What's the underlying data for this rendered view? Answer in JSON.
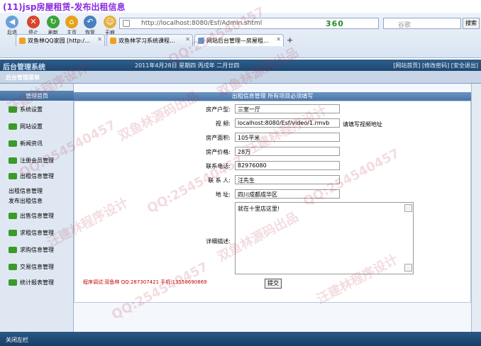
{
  "caption": "(11)jsp房屋租赁-发布出租信息",
  "browser": {
    "nav_buttons": [
      "后退",
      "停止",
      "刷新",
      "主页",
      "恢复",
      "无痕"
    ],
    "address": "http://localhost:8080/Esf/Admin.shtml",
    "brand": "360",
    "search_placeholder": "谷歌",
    "search_button": "搜索",
    "tabs": [
      {
        "label": "双鱼林QQ家园 [http:/..."
      },
      {
        "label": "双鱼林学习系统课程..."
      },
      {
        "label": "网站后台管理—房屋租..."
      }
    ],
    "new_tab": "+"
  },
  "app": {
    "title": "后台管理系统",
    "date_text": "2011年4月28日  星期四  丙戌年  二月廿四",
    "top_links": "[网站首页] [修改密码] [安全退出]",
    "sub_title": "后台管理菜单"
  },
  "sidebar": {
    "head": "管理首页",
    "items": [
      {
        "label": "系统设置"
      },
      {
        "label": "网站设置"
      },
      {
        "label": "新闻资讯"
      },
      {
        "label": "注册会员管理"
      },
      {
        "label": "出租信息管理"
      }
    ],
    "sub_items": [
      "出租信息管理",
      "发布出租信息"
    ],
    "items2": [
      {
        "label": "出售信息管理"
      },
      {
        "label": "求租信息管理"
      },
      {
        "label": "求购信息管理"
      },
      {
        "label": "交易信息管理"
      },
      {
        "label": "统计报表管理"
      }
    ]
  },
  "main": {
    "bar_title": "出租信息管理  所有项目必须填写",
    "fields": {
      "house_type": {
        "label": "房产户型:",
        "value": "三室一厅"
      },
      "video": {
        "label": "视    频:",
        "value": "localhost:8080/Esf/video/1.rmvb",
        "tip": "请填写视频地址"
      },
      "area": {
        "label": "房产面积:",
        "value": "105平米"
      },
      "price": {
        "label": "房产价格:",
        "value": "28万"
      },
      "phone": {
        "label": "联系电话:",
        "value": "82976080"
      },
      "contact": {
        "label": "联 系 人:",
        "value": "汪先生"
      },
      "address": {
        "label": "地    址:",
        "value": "四川成都成华区"
      },
      "details": {
        "label": "详细描述:",
        "value": "就在十里店这里!"
      }
    },
    "footer_note": "程序调试:双鱼林  QQ:287307421  手机:13558690869",
    "submit": "提交"
  },
  "footer": {
    "close": "关闭左栏"
  },
  "watermarks": [
    "双鱼林源码出品",
    "QQ:254540457",
    "汪建林程序设计"
  ]
}
